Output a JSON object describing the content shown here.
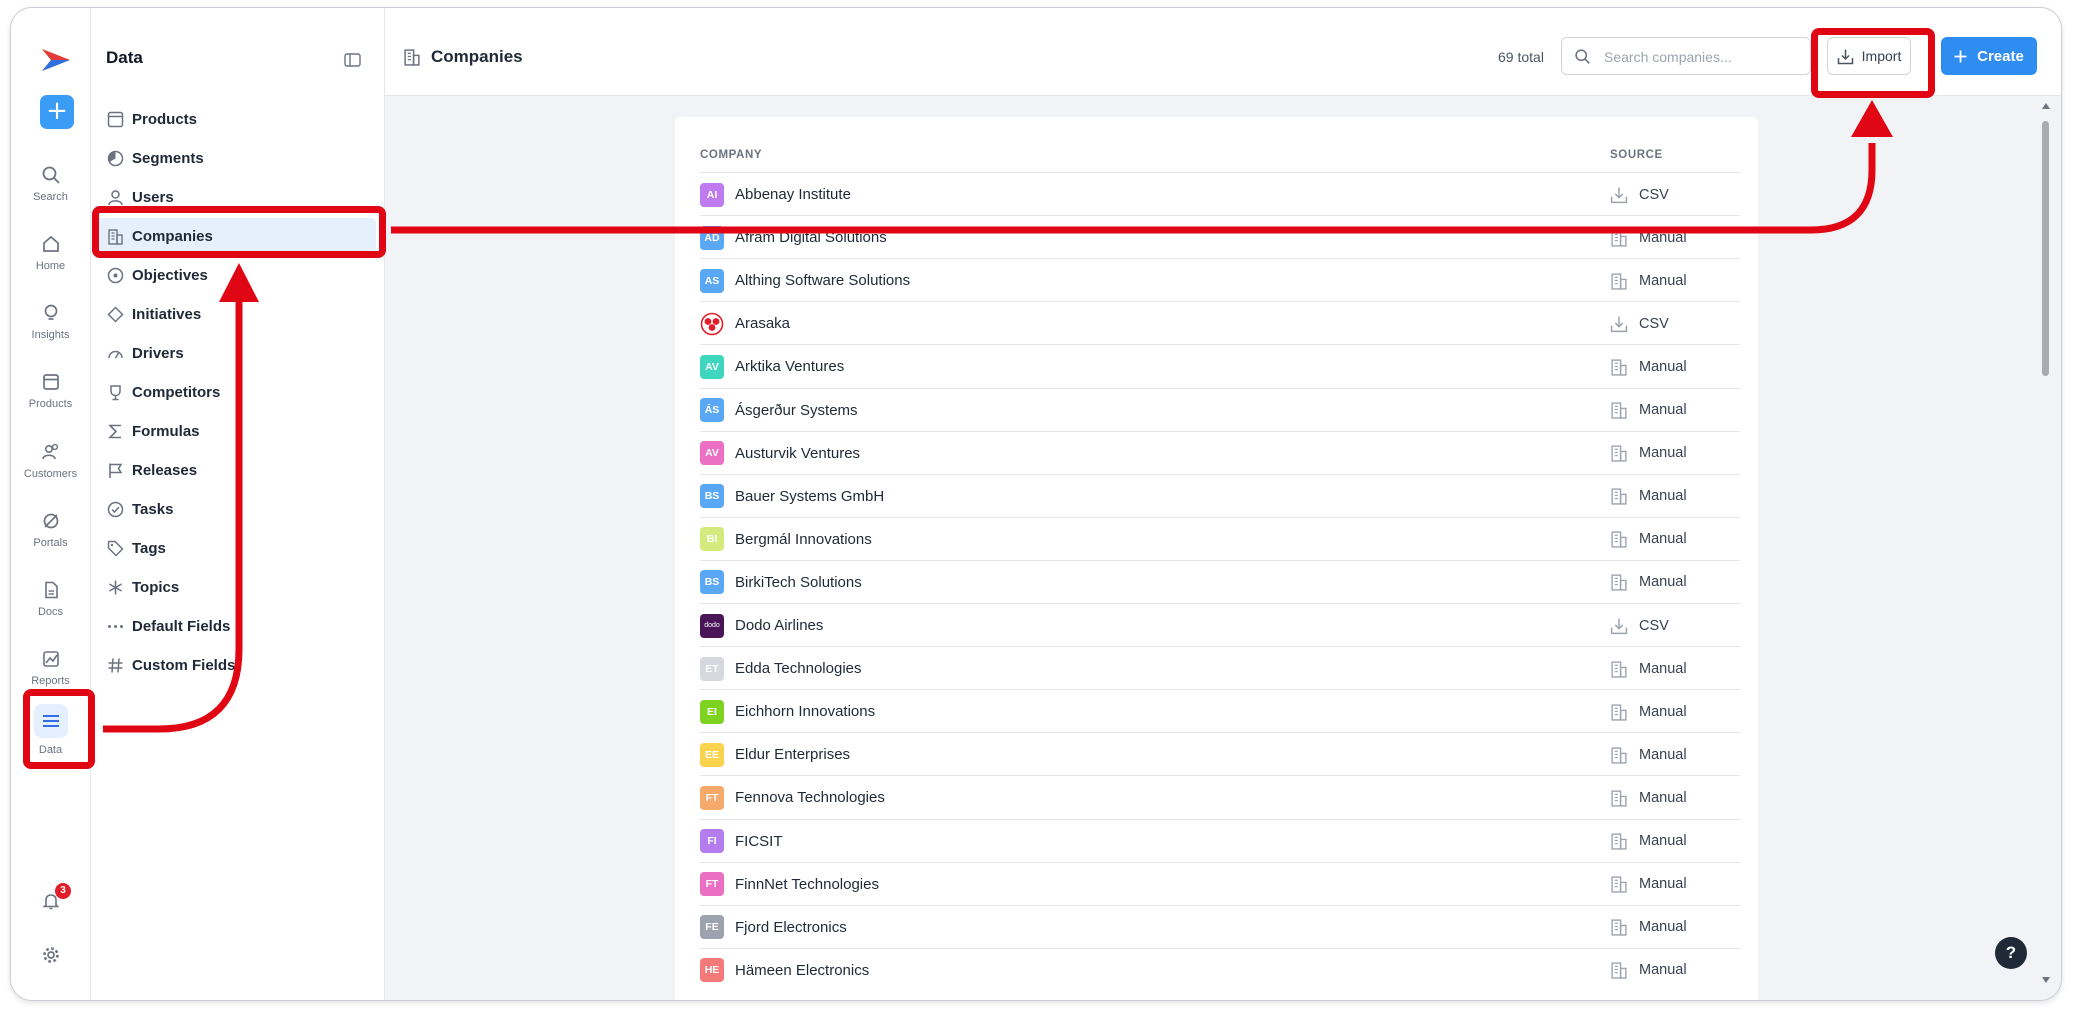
{
  "rail": {
    "new_label": "+",
    "items": [
      {
        "label": "Search",
        "icon": "search-icon"
      },
      {
        "label": "Home",
        "icon": "home-icon"
      },
      {
        "label": "Insights",
        "icon": "lightbulb-icon"
      },
      {
        "label": "Products",
        "icon": "window-icon"
      },
      {
        "label": "Customers",
        "icon": "customers-icon"
      },
      {
        "label": "Portals",
        "icon": "portal-icon"
      },
      {
        "label": "Docs",
        "icon": "document-icon"
      },
      {
        "label": "Reports",
        "icon": "chart-icon"
      },
      {
        "label": "Data",
        "icon": "menu-icon"
      }
    ],
    "notifications_count": "3"
  },
  "sidebar": {
    "title": "Data",
    "items": [
      {
        "label": "Products"
      },
      {
        "label": "Segments"
      },
      {
        "label": "Users"
      },
      {
        "label": "Companies"
      },
      {
        "label": "Objectives"
      },
      {
        "label": "Initiatives"
      },
      {
        "label": "Drivers"
      },
      {
        "label": "Competitors"
      },
      {
        "label": "Formulas"
      },
      {
        "label": "Releases"
      },
      {
        "label": "Tasks"
      },
      {
        "label": "Tags"
      },
      {
        "label": "Topics"
      },
      {
        "label": "Default Fields"
      },
      {
        "label": "Custom Fields"
      }
    ],
    "active": "Companies"
  },
  "header": {
    "title": "Companies",
    "total": "69 total",
    "search_placeholder": "Search companies...",
    "import_label": "Import",
    "create_label": "Create"
  },
  "table": {
    "columns": [
      "COMPANY",
      "SOURCE"
    ],
    "rows": [
      {
        "initials": "AI",
        "color": "#c07af0",
        "name": "Abbenay Institute",
        "source": "CSV"
      },
      {
        "initials": "AD",
        "color": "#5aa8f5",
        "name": "Afram Digital Solutions",
        "source": "Manual"
      },
      {
        "initials": "AS",
        "color": "#5aa8f5",
        "name": "Althing Software Solutions",
        "source": "Manual"
      },
      {
        "initials": "",
        "color": "#e11d2a",
        "name": "Arasaka",
        "source": "CSV"
      },
      {
        "initials": "AV",
        "color": "#3fd6c0",
        "name": "Arktika Ventures",
        "source": "Manual"
      },
      {
        "initials": "ÁS",
        "color": "#5aa8f5",
        "name": "Ásgerður Systems",
        "source": "Manual"
      },
      {
        "initials": "AV",
        "color": "#ec6fc4",
        "name": "Austurvik Ventures",
        "source": "Manual"
      },
      {
        "initials": "BS",
        "color": "#5aa8f5",
        "name": "Bauer Systems GmbH",
        "source": "Manual"
      },
      {
        "initials": "BI",
        "color": "#d4ea7c",
        "name": "Bergmál Innovations",
        "source": "Manual"
      },
      {
        "initials": "BS",
        "color": "#5aa8f5",
        "name": "BirkiTech Solutions",
        "source": "Manual"
      },
      {
        "initials": "dodo",
        "color": "#4b1459",
        "name": "Dodo Airlines",
        "source": "CSV"
      },
      {
        "initials": "ET",
        "color": "#d5d9de",
        "name": "Edda Technologies",
        "source": "Manual"
      },
      {
        "initials": "EI",
        "color": "#7ed321",
        "name": "Eichhorn Innovations",
        "source": "Manual"
      },
      {
        "initials": "EE",
        "color": "#fcd34d",
        "name": "Eldur Enterprises",
        "source": "Manual"
      },
      {
        "initials": "FT",
        "color": "#f5a96b",
        "name": "Fennova Technologies",
        "source": "Manual"
      },
      {
        "initials": "FI",
        "color": "#b57cf0",
        "name": "FICSIT",
        "source": "Manual"
      },
      {
        "initials": "FT",
        "color": "#ec6fc4",
        "name": "FinnNet Technologies",
        "source": "Manual"
      },
      {
        "initials": "FE",
        "color": "#9ca3af",
        "name": "Fjord Electronics",
        "source": "Manual"
      },
      {
        "initials": "HE",
        "color": "#f47a7a",
        "name": "Hämeen Electronics",
        "source": "Manual"
      }
    ]
  },
  "help_label": "?",
  "annotation_color": "#e10613"
}
